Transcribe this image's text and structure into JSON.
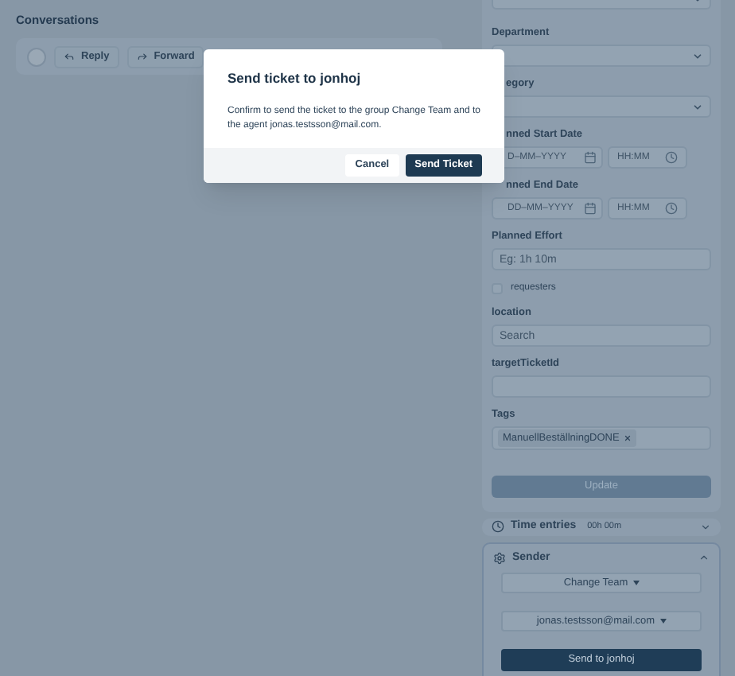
{
  "conversations": {
    "title": "Conversations",
    "actions": [
      {
        "label": "Reply",
        "kind": "reply"
      },
      {
        "label": "Forward",
        "kind": "forward"
      }
    ]
  },
  "form": {
    "fields": [
      {
        "kind": "select",
        "label": "Department"
      },
      {
        "kind": "select",
        "label": "egory"
      },
      {
        "kind": "datetime",
        "label": "nned Start Date",
        "date_placeholder": "D–MM–YYYY",
        "time_placeholder": "HH:MM"
      },
      {
        "kind": "datetime",
        "label": "nned End Date",
        "date_placeholder": "DD–MM–YYYY",
        "time_placeholder": "HH:MM"
      },
      {
        "kind": "text",
        "label": "Planned Effort",
        "placeholder": "Eg: 1h 10m"
      },
      {
        "kind": "checkbox",
        "label": "requesters",
        "checked": false
      },
      {
        "kind": "text",
        "label": "location",
        "placeholder": "Search"
      },
      {
        "kind": "text",
        "label": "targetTicketId"
      },
      {
        "kind": "tags",
        "label": "Tags",
        "tags": [
          "ManuellBeställningDONE"
        ]
      }
    ],
    "update_button": "Update"
  },
  "time_entries": {
    "title": "Time entries",
    "total": "00h 00m",
    "expanded": false
  },
  "sender": {
    "title": "Sender",
    "expanded": true,
    "group": "Change Team",
    "agent": "jonas.testsson@mail.com",
    "send_button": "Send to jonhoj"
  },
  "dialog": {
    "title": "Send ticket to jonhoj",
    "message": "Confirm to send the ticket to the group Change Team and to the agent jonas.testsson@mail.com.",
    "buttons": [
      {
        "label": "Cancel",
        "kind": "secondary"
      },
      {
        "label": "Send Ticket",
        "kind": "primary"
      }
    ]
  }
}
